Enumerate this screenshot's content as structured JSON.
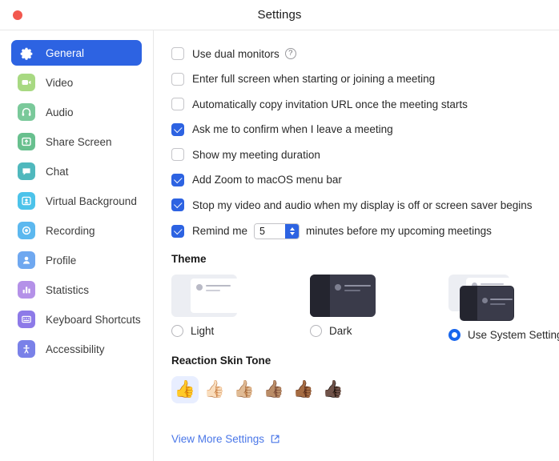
{
  "window": {
    "title": "Settings",
    "traffic_lights": [
      "close"
    ],
    "accent_color": "#2d63e2",
    "close_color": "#f2584e"
  },
  "sidebar": {
    "items": [
      {
        "label": "General",
        "icon": "gear-icon",
        "icon_color": "#2d63e2",
        "active": true
      },
      {
        "label": "Video",
        "icon": "video-camera-icon",
        "icon_color": "#a8d982",
        "active": false
      },
      {
        "label": "Audio",
        "icon": "headphones-icon",
        "icon_color": "#7ac99a",
        "active": false
      },
      {
        "label": "Share Screen",
        "icon": "share-screen-icon",
        "icon_color": "#68c08e",
        "active": false
      },
      {
        "label": "Chat",
        "icon": "chat-bubble-icon",
        "icon_color": "#4fb8bd",
        "active": false
      },
      {
        "label": "Virtual Background",
        "icon": "virtual-background-icon",
        "icon_color": "#4cc3ea",
        "active": false
      },
      {
        "label": "Recording",
        "icon": "record-circle-icon",
        "icon_color": "#5cb8ef",
        "active": false
      },
      {
        "label": "Profile",
        "icon": "person-icon",
        "icon_color": "#6fa8f0",
        "active": false
      },
      {
        "label": "Statistics",
        "icon": "bar-chart-icon",
        "icon_color": "#b491e8",
        "active": false
      },
      {
        "label": "Keyboard Shortcuts",
        "icon": "keyboard-icon",
        "icon_color": "#8d7ae8",
        "active": false
      },
      {
        "label": "Accessibility",
        "icon": "accessibility-icon",
        "icon_color": "#7a81e8",
        "active": false
      }
    ]
  },
  "main": {
    "checkboxes": [
      {
        "label": "Use dual monitors",
        "checked": false,
        "help": true,
        "help_glyph": "?"
      },
      {
        "label": "Enter full screen when starting or joining a meeting",
        "checked": false,
        "help": false
      },
      {
        "label": "Automatically copy invitation URL once the meeting starts",
        "checked": false,
        "help": false
      },
      {
        "label": "Ask me to confirm when I leave a meeting",
        "checked": true,
        "help": false
      },
      {
        "label": "Show my meeting duration",
        "checked": false,
        "help": false
      },
      {
        "label": "Add Zoom to macOS menu bar",
        "checked": true,
        "help": false
      },
      {
        "label": "Stop my video and audio when my display is off or screen saver begins",
        "checked": true,
        "help": false
      }
    ],
    "remind": {
      "checked": true,
      "prefix": "Remind me",
      "value": "5",
      "suffix": "minutes before my upcoming meetings"
    },
    "theme": {
      "heading": "Theme",
      "options": [
        {
          "label": "Light",
          "selected": false,
          "preview": "light-theme-preview"
        },
        {
          "label": "Dark",
          "selected": false,
          "preview": "dark-theme-preview"
        },
        {
          "label": "Use System Setting",
          "selected": true,
          "preview": "system-theme-preview"
        }
      ]
    },
    "skin_tone": {
      "heading": "Reaction Skin Tone",
      "options": [
        {
          "glyph": "👍",
          "name": "thumbs-up-default",
          "selected": true
        },
        {
          "glyph": "👍🏻",
          "name": "thumbs-up-light",
          "selected": false
        },
        {
          "glyph": "👍🏼",
          "name": "thumbs-up-medium-light",
          "selected": false
        },
        {
          "glyph": "👍🏽",
          "name": "thumbs-up-medium",
          "selected": false
        },
        {
          "glyph": "👍🏾",
          "name": "thumbs-up-medium-dark",
          "selected": false
        },
        {
          "glyph": "👍🏿",
          "name": "thumbs-up-dark",
          "selected": false
        }
      ]
    },
    "view_more": {
      "label": "View More Settings",
      "icon": "external-link-icon",
      "color": "#4a77e8"
    }
  }
}
